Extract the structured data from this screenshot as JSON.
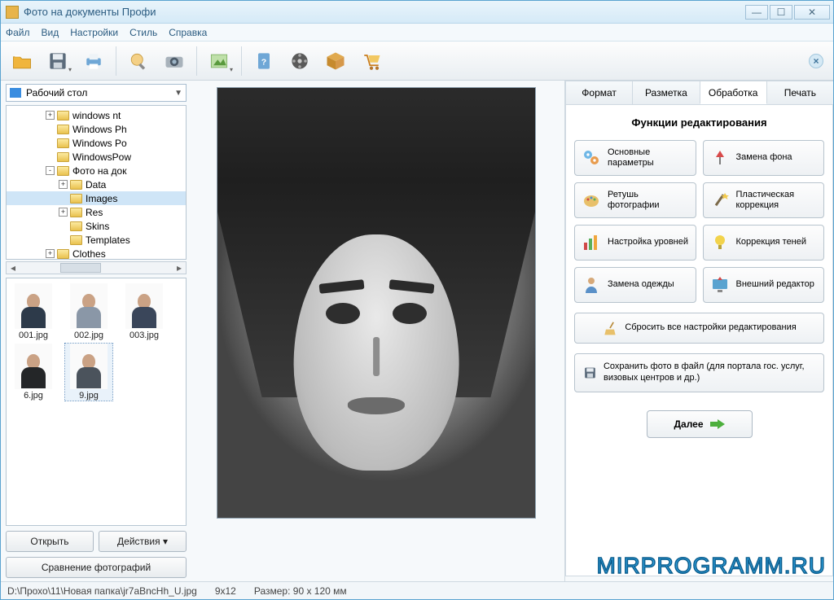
{
  "window": {
    "title": "Фото на документы Профи"
  },
  "menu": {
    "file": "Файл",
    "view": "Вид",
    "settings": "Настройки",
    "style": "Стиль",
    "help": "Справка"
  },
  "sidebar": {
    "path": "Рабочий стол",
    "tree": [
      {
        "indent": 3,
        "toggle": "+",
        "label": "windows nt"
      },
      {
        "indent": 3,
        "toggle": "",
        "label": "Windows Ph"
      },
      {
        "indent": 3,
        "toggle": "",
        "label": "Windows Po"
      },
      {
        "indent": 3,
        "toggle": "",
        "label": "WindowsPow"
      },
      {
        "indent": 3,
        "toggle": "-",
        "label": "Фото на док"
      },
      {
        "indent": 4,
        "toggle": "+",
        "label": "Data"
      },
      {
        "indent": 4,
        "toggle": "",
        "label": "Images",
        "selected": true
      },
      {
        "indent": 4,
        "toggle": "+",
        "label": "Res"
      },
      {
        "indent": 4,
        "toggle": "",
        "label": "Skins"
      },
      {
        "indent": 4,
        "toggle": "",
        "label": "Templates"
      },
      {
        "indent": 3,
        "toggle": "+",
        "label": "Clothes"
      }
    ],
    "thumbs": [
      {
        "name": "001.jpg",
        "color": "c1"
      },
      {
        "name": "002.jpg",
        "color": "c2"
      },
      {
        "name": "003.jpg",
        "color": "c3"
      },
      {
        "name": "6.jpg",
        "color": "c4"
      },
      {
        "name": "9.jpg",
        "color": "c5",
        "selected": true
      }
    ],
    "open": "Открыть",
    "actions": "Действия",
    "compare": "Сравнение фотографий"
  },
  "tabs": {
    "format": "Формат",
    "markup": "Разметка",
    "edit": "Обработка",
    "print": "Печать"
  },
  "panel": {
    "heading": "Функции редактирования",
    "basic": "Основные параметры",
    "bg": "Замена фона",
    "retouch": "Ретушь фотографии",
    "plastic": "Пластическая коррекция",
    "levels": "Настройка уровней",
    "shadows": "Коррекция теней",
    "clothes": "Замена одежды",
    "external": "Внешний редактор",
    "reset": "Сбросить все настройки редактирования",
    "save": "Сохранить фото в файл (для портала гос. услуг, визовых центров и др.)",
    "next": "Далее"
  },
  "status": {
    "path": "D:\\Прохо\\11\\Новая папка\\jr7aBncHh_U.jpg",
    "ratio": "9x12",
    "size": "Размер: 90 x 120 мм"
  },
  "watermark": "MIRPROGRAMM.RU"
}
